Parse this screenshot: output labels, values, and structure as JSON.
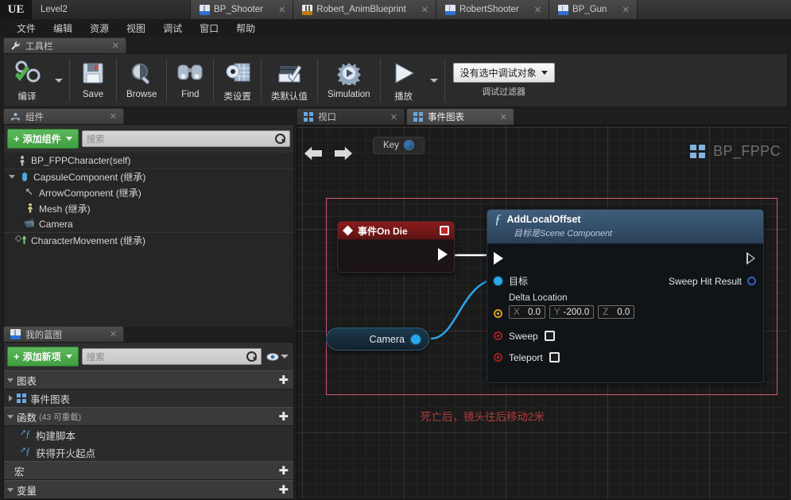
{
  "window": {
    "logo": "UE",
    "tabs": [
      {
        "label": "Level2",
        "icon": "level-icon",
        "active": true,
        "closable": false
      },
      {
        "label": "BP_Shooter",
        "icon": "blueprint-icon",
        "active": false,
        "closable": true
      },
      {
        "label": "Robert_AnimBlueprint",
        "icon": "anim-blueprint-icon",
        "active": false,
        "closable": true
      },
      {
        "label": "RobertShooter",
        "icon": "blueprint-icon",
        "active": false,
        "closable": true
      },
      {
        "label": "BP_Gun",
        "icon": "blueprint-icon",
        "active": false,
        "closable": true
      }
    ],
    "close_glyph": "✕"
  },
  "menubar": {
    "items": [
      "文件",
      "编辑",
      "资源",
      "视图",
      "调试",
      "窗口",
      "帮助"
    ]
  },
  "toolbar_panel": {
    "tab_label": "工具栏",
    "tab_close": "✕",
    "buttons": [
      {
        "label": "编译",
        "icon": "compile-icon",
        "has_dropdown": true
      },
      {
        "label": "Save",
        "icon": "save-icon",
        "has_dropdown": false
      },
      {
        "label": "Browse",
        "icon": "browse-icon",
        "has_dropdown": false
      },
      {
        "label": "Find",
        "icon": "find-icon",
        "has_dropdown": false
      },
      {
        "label": "类设置",
        "icon": "class-settings-icon",
        "has_dropdown": false
      },
      {
        "label": "类默认值",
        "icon": "class-defaults-icon",
        "has_dropdown": false
      },
      {
        "label": "Simulation",
        "icon": "simulation-icon",
        "has_dropdown": false
      },
      {
        "label": "播放",
        "icon": "play-icon",
        "has_dropdown": true
      }
    ],
    "debug": {
      "selected": "没有选中调试对象",
      "caption": "调试过滤器"
    }
  },
  "components_panel": {
    "tab_label": "组件",
    "tab_close": "✕",
    "add_button": "添加组件",
    "search_placeholder": "搜索",
    "tree": [
      {
        "label": "BP_FPPCharacter(self)",
        "icon": "character-icon",
        "indent": 0,
        "arrow": "none",
        "separator_below": true
      },
      {
        "label": "CapsuleComponent (继承)",
        "icon": "capsule-icon",
        "indent": 0,
        "arrow": "open"
      },
      {
        "label": "ArrowComponent (继承)",
        "icon": "arrow-component-icon",
        "indent": 1,
        "arrow": "none"
      },
      {
        "label": "Mesh (继承)",
        "icon": "mesh-icon",
        "indent": 1,
        "arrow": "none"
      },
      {
        "label": "Camera",
        "icon": "camera-icon",
        "indent": 1,
        "arrow": "none",
        "separator_below": true
      },
      {
        "label": "CharacterMovement (继承)",
        "icon": "movement-icon",
        "indent": 0,
        "arrow": "none"
      }
    ]
  },
  "myblueprint_panel": {
    "tab_label": "我的蓝图",
    "tab_close": "✕",
    "add_button": "添加新项",
    "search_placeholder": "搜索",
    "sections": [
      {
        "label": "图表",
        "suffix": "",
        "expanded": true,
        "plus": "✚",
        "items": [
          {
            "label": "事件图表",
            "icon": "graph-icon",
            "arrow": "closed"
          }
        ]
      },
      {
        "label": "函数",
        "suffix": "(43 可重载)",
        "expanded": true,
        "plus": "✚",
        "items": [
          {
            "label": "构建脚本",
            "icon": "function-icon",
            "arrow": "none"
          },
          {
            "label": "获得开火起点",
            "icon": "function-icon",
            "arrow": "none"
          }
        ]
      },
      {
        "label": "宏",
        "suffix": "",
        "expanded": false,
        "plus": "✚",
        "items": []
      },
      {
        "label": "变量",
        "suffix": "",
        "expanded": true,
        "plus": "✚",
        "items": []
      }
    ]
  },
  "graph_panel": {
    "tabs": [
      {
        "label": "视口",
        "icon": "viewport-icon",
        "active": false,
        "close": "✕"
      },
      {
        "label": "事件图表",
        "icon": "event-graph-icon",
        "active": true,
        "close": "✕"
      }
    ],
    "key_tooltip": "Key",
    "graph_title": "BP_FPPC",
    "comment": "死亡后，镜头往后移动2米",
    "nodes": {
      "event": {
        "title": "事件On Die",
        "icon": "event-diamond-icon",
        "badge": "event-record-icon"
      },
      "function": {
        "title": "AddLocalOffset",
        "subtitle": "目标是Scene Component",
        "symbol": "ƒ",
        "inputs": [
          {
            "name": "目标",
            "type": "object",
            "pin": "blue"
          }
        ],
        "outputs": [
          {
            "name": "Sweep Hit Result",
            "type": "struct",
            "pin": "blue-hollow"
          }
        ],
        "delta_location": {
          "label": "Delta Location",
          "x_axis": "X",
          "x": "0.0",
          "y_axis": "Y",
          "y": "-200.0",
          "z_axis": "Z",
          "z": "0.0"
        },
        "booleans": [
          {
            "name": "Sweep",
            "checked": false
          },
          {
            "name": "Teleport",
            "checked": false
          }
        ]
      },
      "variable": {
        "name": "Camera"
      }
    }
  }
}
